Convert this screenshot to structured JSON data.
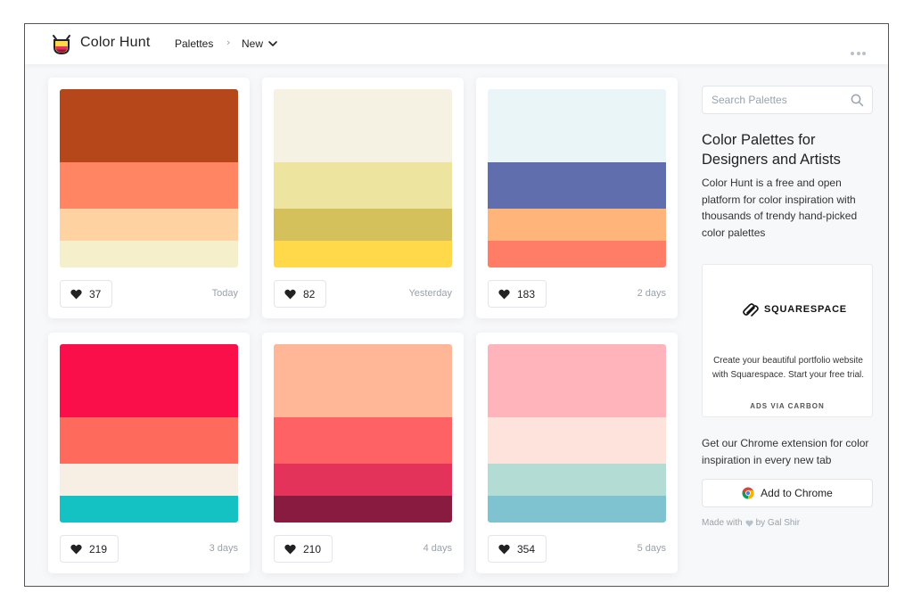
{
  "header": {
    "brand": "Color Hunt",
    "nav_palettes": "Palettes",
    "nav_separator": "›",
    "nav_new": "New"
  },
  "palettes": [
    {
      "colors": [
        "#b5471b",
        "#ff8563",
        "#ffd3a1",
        "#f6efcc"
      ],
      "likes": "37",
      "date": "Today"
    },
    {
      "colors": [
        "#f5f2e3",
        "#ede4a0",
        "#d4c15c",
        "#ffd94a"
      ],
      "likes": "82",
      "date": "Yesterday"
    },
    {
      "colors": [
        "#eaf5f8",
        "#616eae",
        "#ffb47a",
        "#ff7c66"
      ],
      "likes": "183",
      "date": "2 days"
    },
    {
      "colors": [
        "#fb0f4b",
        "#fe6b5c",
        "#f7efe3",
        "#14c2c3"
      ],
      "likes": "219",
      "date": "3 days"
    },
    {
      "colors": [
        "#ffb797",
        "#ff6264",
        "#e3335a",
        "#8a1b40"
      ],
      "likes": "210",
      "date": "4 days"
    },
    {
      "colors": [
        "#ffb4bb",
        "#fde3dc",
        "#b3ddd4",
        "#7ec3cf"
      ],
      "likes": "354",
      "date": "5 days"
    }
  ],
  "sidebar": {
    "search_placeholder": "Search Palettes",
    "title": "Color Palettes for Designers and Artists",
    "description": "Color Hunt is a free and open platform for color inspiration with thousands of trendy hand-picked color palettes",
    "ad": {
      "brand": "SQUARESPACE",
      "text": "Create your beautiful portfolio website with Squarespace. Start your free trial.",
      "via": "ADS VIA CARBON"
    },
    "extension_text": "Get our Chrome extension for color inspiration in every new tab",
    "chrome_button": "Add to Chrome",
    "made_with_prefix": "Made with",
    "made_with_suffix": "by Gal Shir"
  }
}
